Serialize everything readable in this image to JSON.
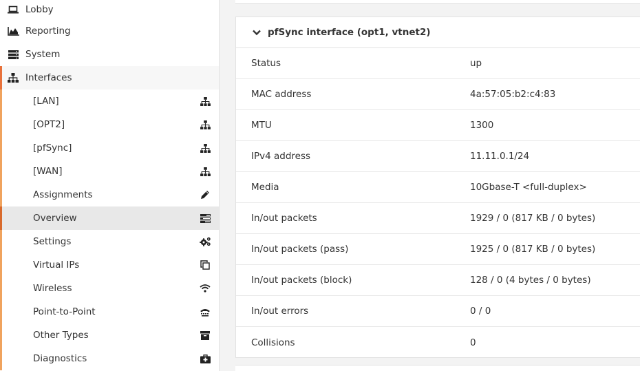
{
  "sidebar": {
    "top_items": [
      {
        "label": "Lobby",
        "icon": "laptop-icon"
      },
      {
        "label": "Reporting",
        "icon": "area-chart-icon"
      },
      {
        "label": "System",
        "icon": "server-icon"
      },
      {
        "label": "Interfaces",
        "icon": "sitemap-icon"
      }
    ],
    "sub_items": [
      {
        "label": "[LAN]",
        "icon": "sitemap-icon"
      },
      {
        "label": "[OPT2]",
        "icon": "sitemap-icon"
      },
      {
        "label": "[pfSync]",
        "icon": "sitemap-icon"
      },
      {
        "label": "[WAN]",
        "icon": "sitemap-icon"
      },
      {
        "label": "Assignments",
        "icon": "pencil-icon"
      },
      {
        "label": "Overview",
        "icon": "tasks-icon"
      },
      {
        "label": "Settings",
        "icon": "cogs-icon"
      },
      {
        "label": "Virtual IPs",
        "icon": "clone-icon"
      },
      {
        "label": "Wireless",
        "icon": "wifi-icon"
      },
      {
        "label": "Point-to-Point",
        "icon": "tty-icon"
      },
      {
        "label": "Other Types",
        "icon": "archive-icon"
      },
      {
        "label": "Diagnostics",
        "icon": "medkit-icon"
      }
    ],
    "accent_color": "#e8713a"
  },
  "panel": {
    "title": "pfSync interface (opt1, vtnet2)",
    "rows": [
      {
        "key": "Status",
        "value": "up"
      },
      {
        "key": "MAC address",
        "value": "4a:57:05:b2:c4:83"
      },
      {
        "key": "MTU",
        "value": "1300"
      },
      {
        "key": "IPv4 address",
        "value": "11.11.0.1/24"
      },
      {
        "key": "Media",
        "value": "10Gbase-T <full-duplex>"
      },
      {
        "key": "In/out packets",
        "value": "1929 / 0 (817 KB / 0 bytes)"
      },
      {
        "key": "In/out packets (pass)",
        "value": "1925 / 0 (817 KB / 0 bytes)"
      },
      {
        "key": "In/out packets (block)",
        "value": "128 / 0 (4 bytes / 0 bytes)"
      },
      {
        "key": "In/out errors",
        "value": "0 / 0"
      },
      {
        "key": "Collisions",
        "value": "0"
      }
    ]
  }
}
